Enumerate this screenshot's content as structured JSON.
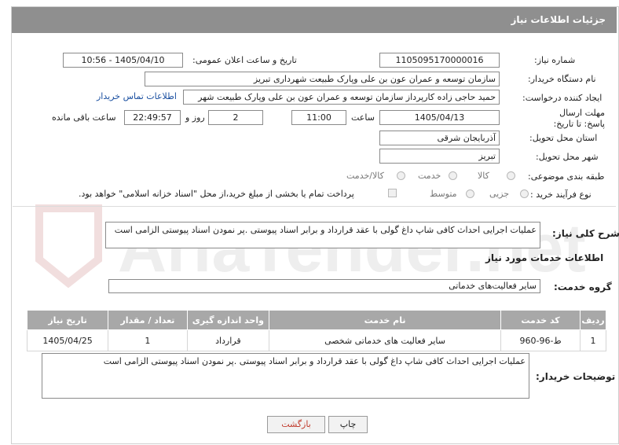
{
  "header": {
    "title": "جزئیات اطلاعات نیاز"
  },
  "form": {
    "need_number": {
      "label": "شماره نیاز:",
      "value": "1105095170000016"
    },
    "announce": {
      "label": "تاریخ و ساعت اعلان عمومی:",
      "value": "1405/04/10 - 10:56"
    },
    "buyer_org": {
      "label": "نام دستگاه خریدار:",
      "value": "سازمان توسعه و عمران عون بن علی وپارک طبیعت شهرداری تبریز"
    },
    "requester": {
      "label": "ایجاد کننده درخواست:",
      "value": "حمید حاجی زاده کارپرداز سازمان توسعه و عمران عون بن علی وپارک طبیعت شهر",
      "contact_link": "اطلاعات تماس خریدار"
    },
    "deadline": {
      "label": "مهلت ارسال پاسخ: تا تاریخ:",
      "date": "1405/04/13",
      "time_label": "ساعت",
      "time": "11:00",
      "days": "2",
      "days_label": "روز و",
      "remaining": "22:49:57",
      "remaining_label": "ساعت باقی مانده"
    },
    "province": {
      "label": "استان محل تحویل:",
      "value": "آذربایجان شرقی"
    },
    "city": {
      "label": "شهر محل تحویل:",
      "value": "تبریز"
    },
    "category": {
      "label": "طبقه بندی موضوعی:",
      "options": [
        "کالا",
        "خدمت",
        "کالا/خدمت"
      ],
      "selected": "خدمت"
    },
    "process": {
      "label": "نوع فرآیند خرید :",
      "options": [
        "جزیی",
        "متوسط"
      ],
      "selected": "جزیی",
      "payment_note": "پرداخت تمام یا بخشی از مبلغ خرید،از محل \"اسناد خزانه اسلامی\" خواهد بود."
    }
  },
  "summary": {
    "label": "شرح کلی نیاز:",
    "value": "عملیات اجرایی احداث کافی شاپ داغ گولی با عقد قرارداد و برابر اسناد پیوستی .پر نمودن اسناد پیوستی الزامی است"
  },
  "services": {
    "section_title": "اطلاعات خدمات مورد نیاز",
    "group_label": "گروه خدمت:",
    "group_value": "سایر فعالیت‌های خدماتی",
    "columns": [
      "ردیف",
      "کد خدمت",
      "نام خدمت",
      "واحد اندازه گیری",
      "تعداد / مقدار",
      "تاریخ نیاز"
    ],
    "rows": [
      [
        "1",
        "ط-96-960",
        "سایر فعالیت های خدماتی شخصی",
        "قرارداد",
        "1",
        "1405/04/25"
      ]
    ]
  },
  "buyer_notes": {
    "label": "توضیحات خریدار:",
    "value": "عملیات اجرایی احداث کافی شاپ داغ گولی با عقد قرارداد و برابر اسناد پیوستی .پر نمودن اسناد پیوستی الزامی است"
  },
  "buttons": {
    "print": "چاپ",
    "back": "بازگشت"
  },
  "watermark": {
    "text": "AriaTender.net"
  },
  "colors": {
    "header_bg": "#8f8f8f",
    "table_header_bg": "#a8a8a8",
    "link": "#1a4fa0",
    "back_button_text": "#c0392b"
  }
}
